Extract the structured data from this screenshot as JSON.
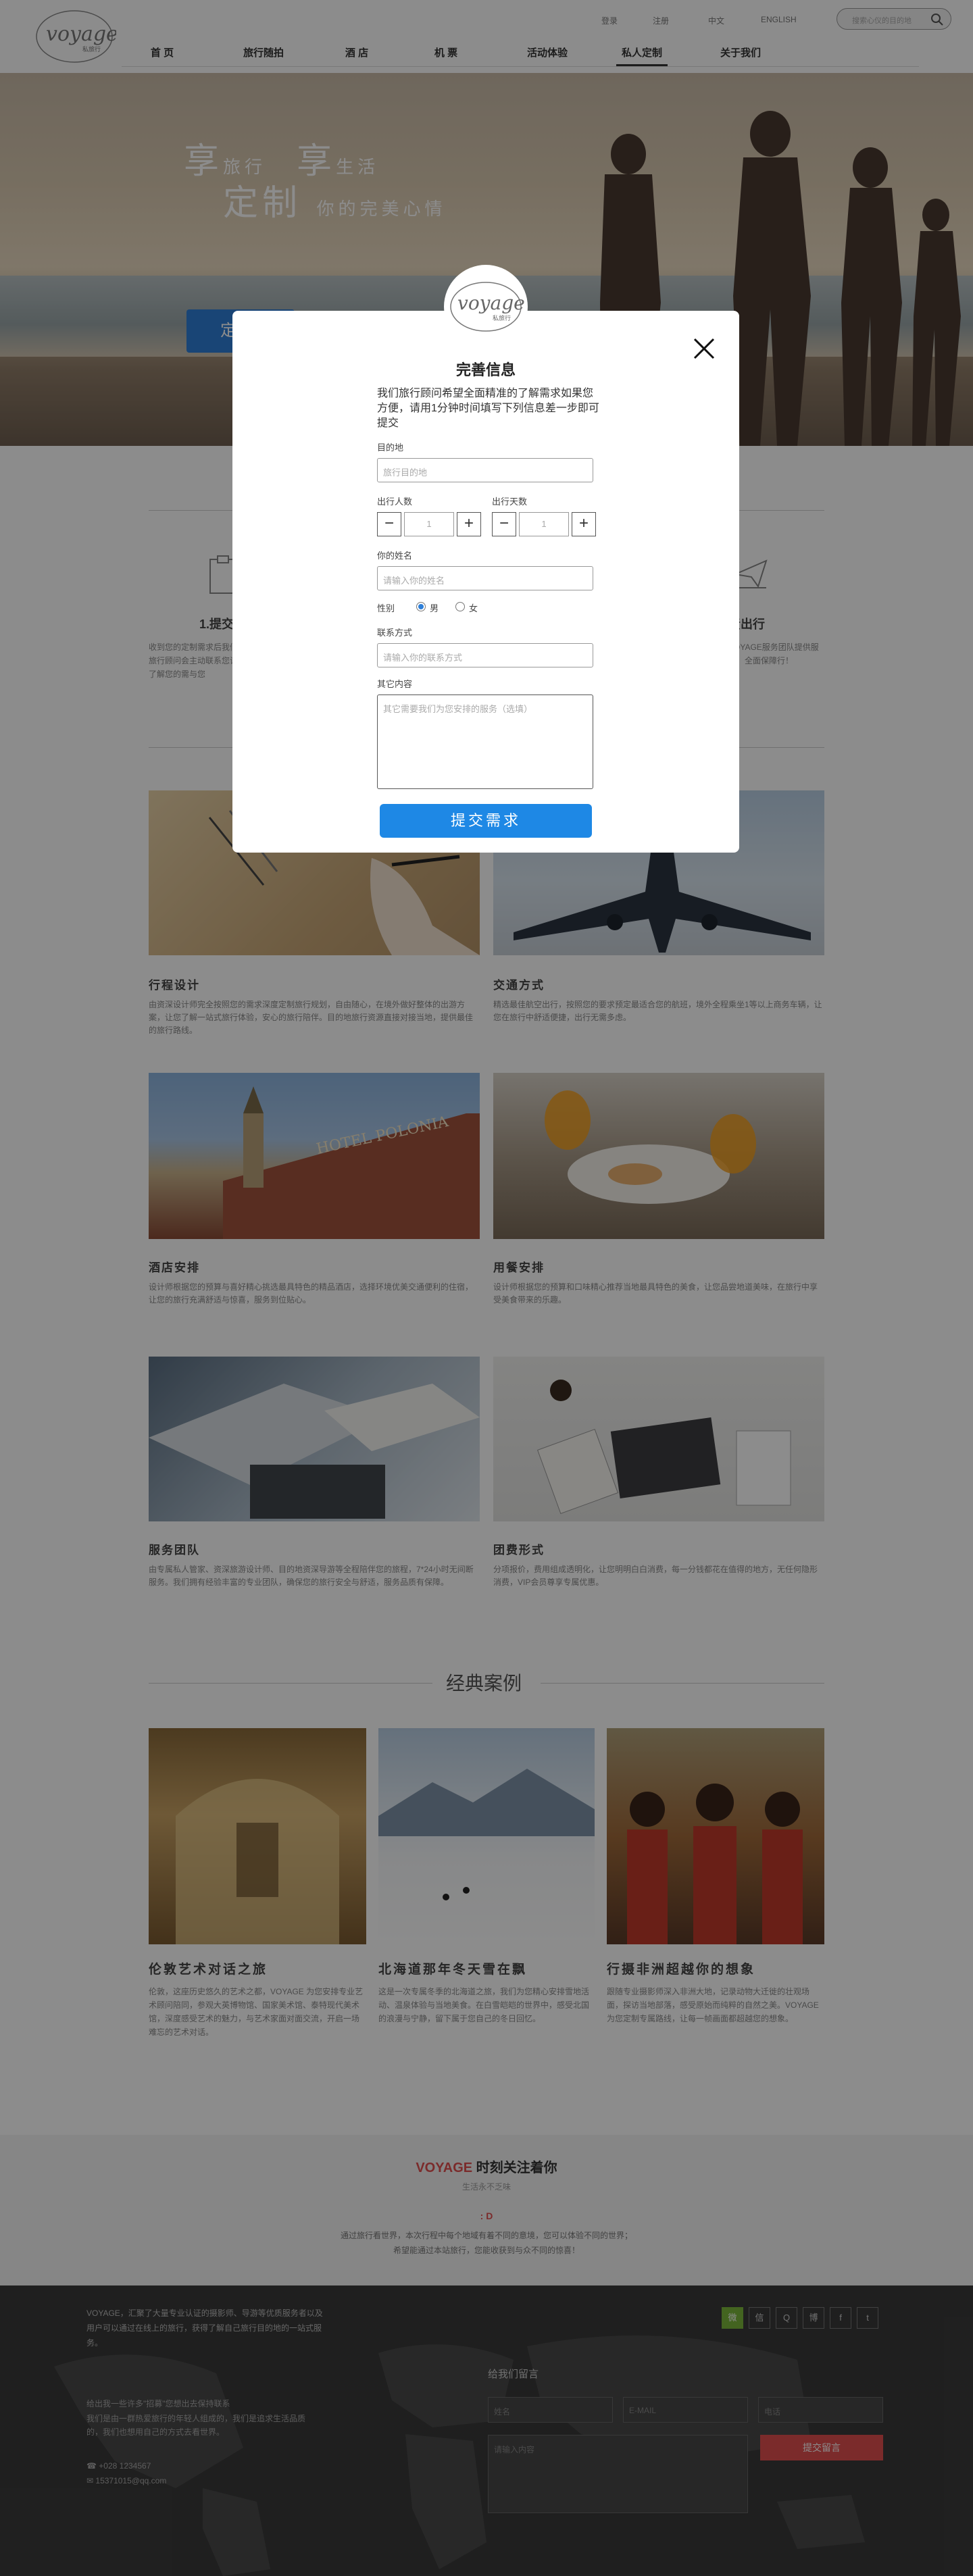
{
  "header": {
    "logo_text": "voyage",
    "logo_sub": "私旅行",
    "top_links": [
      "登录",
      "注册",
      "中文",
      "ENGLISH"
    ],
    "search_placeholder": "搜索心仪的目的地",
    "nav": [
      "首 页",
      "旅行随拍",
      "酒 店",
      "机 票",
      "活动体验",
      "私人定制",
      "关于我们"
    ],
    "nav_active": "私人定制"
  },
  "hero": {
    "line1_big1": "享",
    "line1_small1": "旅行",
    "line1_big2": "享",
    "line1_small2": "生活",
    "line2_big": "定制",
    "line2_small": "你的完美心情",
    "button_fragment": "定"
  },
  "steps": [
    {
      "title": "1.提交",
      "desc": "收到您的定制需求后我们会旅行顾问会主动联系您详细了解您的需与您"
    },
    {
      "title": "责出行",
      "desc": "VOYAGE服务团队提供服务，全面保障行！"
    }
  ],
  "services": [
    {
      "title": "行程设计",
      "desc": "由资深设计师完全按照您的需求深度定制旅行规划，自由随心，在境外做好整体的出游方案，让您了解一站式旅行体验，安心的旅行陪伴。目的地旅行资源直接对接当地，提供最佳的旅行路线。"
    },
    {
      "title": "交通方式",
      "desc": "精选最佳航空出行，按照您的要求预定最适合您的航班，境外全程乘坐1等以上商务车辆，让您在旅行中舒适便捷，出行无需多虑。"
    },
    {
      "title": "酒店安排",
      "desc": "设计师根据您的预算与喜好精心挑选最具特色的精品酒店，选择环境优美交通便利的住宿，让您的旅行充满舒适与惊喜，服务到位贴心。"
    },
    {
      "title": "用餐安排",
      "desc": "设计师根据您的预算和口味精心推荐当地最具特色的美食，让您品尝地道美味，在旅行中享受美食带来的乐趣。"
    },
    {
      "title": "服务团队",
      "desc": "由专属私人管家、资深旅游设计师、目的地资深导游等全程陪伴您的旅程，7*24小时无间断服务。我们拥有经验丰富的专业团队，确保您的旅行安全与舒适，服务品质有保障。"
    },
    {
      "title": "团费形式",
      "desc": "分项报价，费用组成透明化，让您明明白白消费，每一分钱都花在值得的地方，无任何隐形消费，VIP会员尊享专属优惠。"
    }
  ],
  "cases": {
    "title": "经典案例",
    "items": [
      {
        "title": "伦敦艺术对话之旅",
        "desc": "伦敦，这座历史悠久的艺术之都，VOYAGE 为您安排专业艺术顾问陪同，参观大英博物馆、国家美术馆、泰特现代美术馆，深度感受艺术的魅力，与艺术家面对面交流，开启一场难忘的艺术对话。"
      },
      {
        "title": "北海道那年冬天雪在飘",
        "desc": "这是一次专属冬季的北海道之旅，我们为您精心安排雪地活动、温泉体验与当地美食。在白雪皑皑的世界中，感受北国的浪漫与宁静，留下属于您自己的冬日回忆。"
      },
      {
        "title": "行摄非洲超越你的想象",
        "desc": "跟随专业摄影师深入非洲大地，记录动物大迁徙的壮观场面，探访当地部落，感受原始而纯粹的自然之美。VOYAGE 为您定制专属路线，让每一帧画面都超越您的想象。"
      }
    ]
  },
  "follow": {
    "brand": "VOYAGE",
    "title_rest": " 时刻关注着你",
    "subtitle": "生活永不乏味",
    "d": ": D",
    "line1": "通过旅行看世界，本次行程中每个地域有着不同的意境，您可以体验不同的世界；",
    "line2": "希望能通过本站旅行，您能收获到与众不同的惊喜！"
  },
  "footer": {
    "about": "VOYAGE，汇聚了大量专业认证的摄影师、导游等优质服务者以及用户可以通过在线上的旅行，获得了解自己旅行目的地的一站式服务。",
    "socials": [
      "微",
      "信",
      "Q",
      "博",
      "f",
      "t"
    ],
    "msg_title": "给我们留言",
    "name_ph": "姓名",
    "email_ph": "E-MAIL",
    "phone_ph": "电话",
    "content_ph": "请输入内容",
    "submit": "提交留言",
    "info1": "给出我一些许多\"招募\"您想出去保持联系",
    "info2": "我们是由一群热爱旅行的年轻人组成的，我们是追求生活品质的，我们也想用自己的方式去看世界。",
    "phone": "+028 1234567",
    "email": "15371015@qq.com"
  },
  "modal": {
    "logo_text": "voyage",
    "logo_sub": "私旅行",
    "title": "完善信息",
    "intro": "我们旅行顾问希望全面精准的了解需求如果您方便，请用1分钟时间填写下列信息差一步即可提交",
    "dest_label": "目的地",
    "dest_ph": "旅行目的地",
    "people_label": "出行人数",
    "days_label": "出行天数",
    "people_val": "1",
    "days_val": "1",
    "minus": "−",
    "plus": "+",
    "name_label": "你的姓名",
    "name_ph": "请输入你的姓名",
    "gender_label": "性别",
    "male": "男",
    "female": "女",
    "contact_label": "联系方式",
    "contact_ph": "请输入你的联系方式",
    "other_label": "其它内容",
    "other_ph": "其它需要我们为您安排的服务（选填）",
    "submit": "提交需求"
  }
}
